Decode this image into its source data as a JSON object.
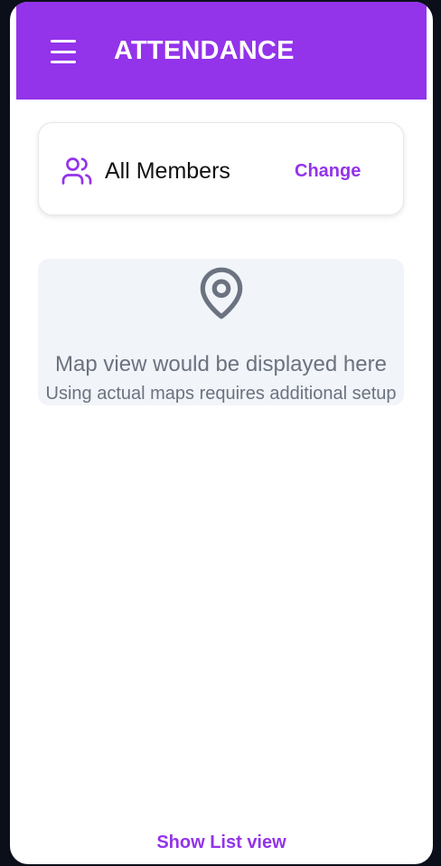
{
  "header": {
    "title": "ATTENDANCE",
    "menu_icon": "hamburger-menu-icon"
  },
  "member_filter": {
    "icon": "users-icon",
    "label": "All Members",
    "change_label": "Change"
  },
  "map": {
    "icon": "map-pin-icon",
    "title": "Map view would be displayed here",
    "subtitle": "Using actual maps requires additional setup"
  },
  "footer": {
    "list_view_label": "Show List view"
  },
  "colors": {
    "primary": "#9333ea",
    "map_background": "#f1f4f8",
    "muted_text": "#6b7280"
  }
}
